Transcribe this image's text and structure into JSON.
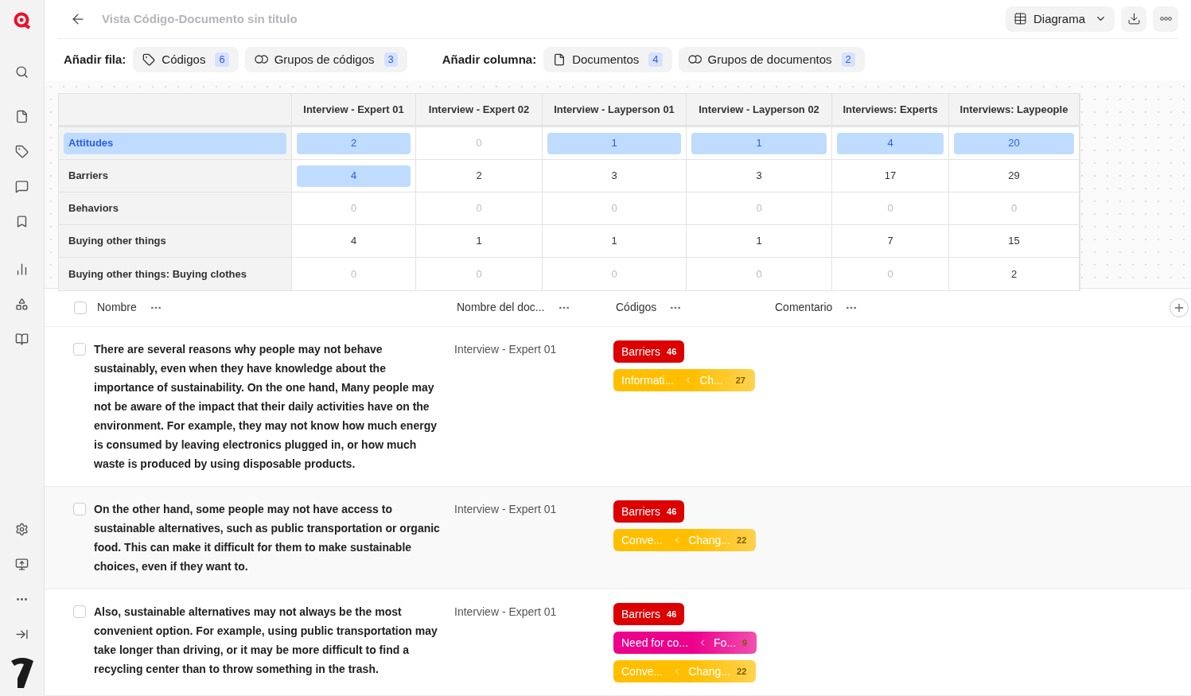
{
  "header": {
    "title": "Vista Código-Documento sin título",
    "view_button": "Diagrama"
  },
  "toolbar": {
    "row_label": "Añadir fila:",
    "row_chips": [
      {
        "kind": "tag",
        "label": "Códigos",
        "count": "6"
      },
      {
        "kind": "group",
        "label": "Grupos de códigos",
        "count": "3"
      }
    ],
    "column_label": "Añadir columna:",
    "column_chips": [
      {
        "kind": "doc",
        "label": "Documentos",
        "count": "4"
      },
      {
        "kind": "group",
        "label": "Grupos de documentos",
        "count": "2"
      }
    ]
  },
  "matrix": {
    "columns": [
      "Interview - Expert 01",
      "Interview - Expert 02",
      "Interview - Layperson 01",
      "Interview - Layperson 02",
      "Interviews: Experts",
      "Interviews: Laypeople"
    ],
    "rows": [
      {
        "label": "Attitudes",
        "selected": true,
        "cells": [
          {
            "value": "2",
            "selected": true,
            "dimmed": false
          },
          {
            "value": "0",
            "selected": false,
            "dimmed": true
          },
          {
            "value": "1",
            "selected": true,
            "dimmed": false
          },
          {
            "value": "1",
            "selected": true,
            "dimmed": false
          },
          {
            "value": "4",
            "selected": true,
            "dimmed": false
          },
          {
            "value": "20",
            "selected": true,
            "dimmed": false
          }
        ]
      },
      {
        "label": "Barriers",
        "selected": false,
        "cells": [
          {
            "value": "4",
            "selected": true,
            "dimmed": false
          },
          {
            "value": "2",
            "selected": false,
            "dimmed": false
          },
          {
            "value": "3",
            "selected": false,
            "dimmed": false
          },
          {
            "value": "3",
            "selected": false,
            "dimmed": false
          },
          {
            "value": "17",
            "selected": false,
            "dimmed": false
          },
          {
            "value": "29",
            "selected": false,
            "dimmed": false
          }
        ]
      },
      {
        "label": "Behaviors",
        "selected": false,
        "cells": [
          {
            "value": "0",
            "selected": false,
            "dimmed": true
          },
          {
            "value": "0",
            "selected": false,
            "dimmed": true
          },
          {
            "value": "0",
            "selected": false,
            "dimmed": true
          },
          {
            "value": "0",
            "selected": false,
            "dimmed": true
          },
          {
            "value": "0",
            "selected": false,
            "dimmed": true
          },
          {
            "value": "0",
            "selected": false,
            "dimmed": true
          }
        ]
      },
      {
        "label": "Buying other things",
        "selected": false,
        "cells": [
          {
            "value": "4",
            "selected": false,
            "dimmed": false
          },
          {
            "value": "1",
            "selected": false,
            "dimmed": false
          },
          {
            "value": "1",
            "selected": false,
            "dimmed": false
          },
          {
            "value": "1",
            "selected": false,
            "dimmed": false
          },
          {
            "value": "7",
            "selected": false,
            "dimmed": false
          },
          {
            "value": "15",
            "selected": false,
            "dimmed": false
          }
        ]
      },
      {
        "label": "Buying other things: Buying clothes",
        "selected": false,
        "cells": [
          {
            "value": "0",
            "selected": false,
            "dimmed": true
          },
          {
            "value": "0",
            "selected": false,
            "dimmed": true
          },
          {
            "value": "0",
            "selected": false,
            "dimmed": true
          },
          {
            "value": "0",
            "selected": false,
            "dimmed": true
          },
          {
            "value": "0",
            "selected": false,
            "dimmed": true
          },
          {
            "value": "2",
            "selected": false,
            "dimmed": false
          }
        ]
      }
    ]
  },
  "quotes": {
    "select_all_checked": false,
    "columns": [
      {
        "label": "Nombre"
      },
      {
        "label": "Nombre del doc..."
      },
      {
        "label": "Códigos"
      },
      {
        "label": "Comentario"
      }
    ],
    "rows": [
      {
        "checked": false,
        "text": "There are several reasons why people may not behave sustainably, even when they have knowledge about the importance of sustainability. On the one hand, Many people may not be aware of the impact that their daily activities have on the environment. For example, they may not know how much energy is consumed by leaving electronics plugged in, or how much waste is produced by using disposable products.",
        "document": "Interview - Expert 01",
        "codes": [
          {
            "kind": "single",
            "label": "Barriers",
            "count": "46",
            "color": "#dc0000"
          },
          {
            "kind": "nested",
            "label": "Informati...",
            "parent": "Ch...",
            "count": "27",
            "color": "#ffbf00"
          }
        ]
      },
      {
        "checked": false,
        "text": "On the other hand, some people may not have access to sustainable alternatives, such as public transportation or organic food. This can make it difficult for them to make sustainable choices, even if they want to.",
        "document": "Interview - Expert 01",
        "codes": [
          {
            "kind": "single",
            "label": "Barriers",
            "count": "46",
            "color": "#dc0000"
          },
          {
            "kind": "nested",
            "label": "Conve...",
            "parent": "Chang...",
            "count": "22",
            "color": "#ffbf00"
          }
        ]
      },
      {
        "checked": false,
        "text": "Also, sustainable alternatives may not always be the most convenient option. For example, using public transportation may take longer than driving, or it may be more difficult to find a recycling center than to throw something in the trash.",
        "document": "Interview - Expert 01",
        "codes": [
          {
            "kind": "single",
            "label": "Barriers",
            "count": "46",
            "color": "#dc0000"
          },
          {
            "kind": "nested",
            "label": "Need for co...",
            "parent": "Fo...",
            "count": "9",
            "color": "#ec008c"
          },
          {
            "kind": "nested",
            "label": "Conve...",
            "parent": "Chang...",
            "count": "22",
            "color": "#ffbf00"
          }
        ]
      }
    ]
  }
}
